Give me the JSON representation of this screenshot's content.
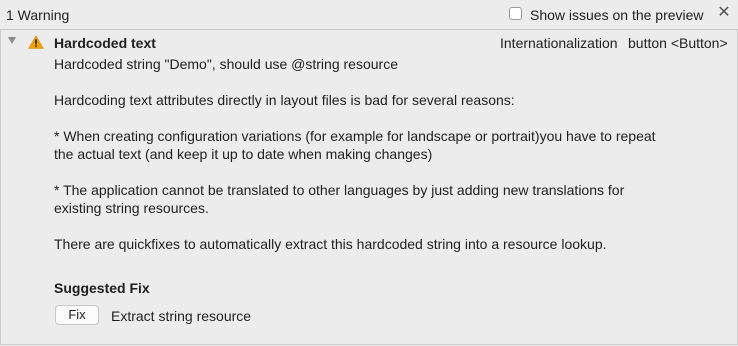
{
  "header": {
    "count_label": "1 Warning",
    "show_preview_label": "Show issues on the preview",
    "show_preview_checked": false,
    "close_icon": "close-icon"
  },
  "issue": {
    "severity_icon": "warning-icon",
    "title": "Hardcoded text",
    "category": "Internationalization",
    "target": "button <Button>",
    "summary": "Hardcoded string \"Demo\", should use @string resource",
    "paragraphs": [
      "Hardcoding text attributes directly in layout files is bad for several reasons:",
      "* When creating configuration variations (for example for landscape or portrait)you have to repeat the actual text (and keep it up to date when making changes)",
      "* The application cannot be translated to other languages by just adding new translations for existing string resources.",
      "There are quickfixes to automatically extract this hardcoded string into a resource lookup."
    ],
    "suggested_fix_heading": "Suggested Fix",
    "fix_button_label": "Fix",
    "fix_description": "Extract string resource"
  },
  "colors": {
    "background": "#ececec",
    "warning_icon": "#f0a30a"
  }
}
